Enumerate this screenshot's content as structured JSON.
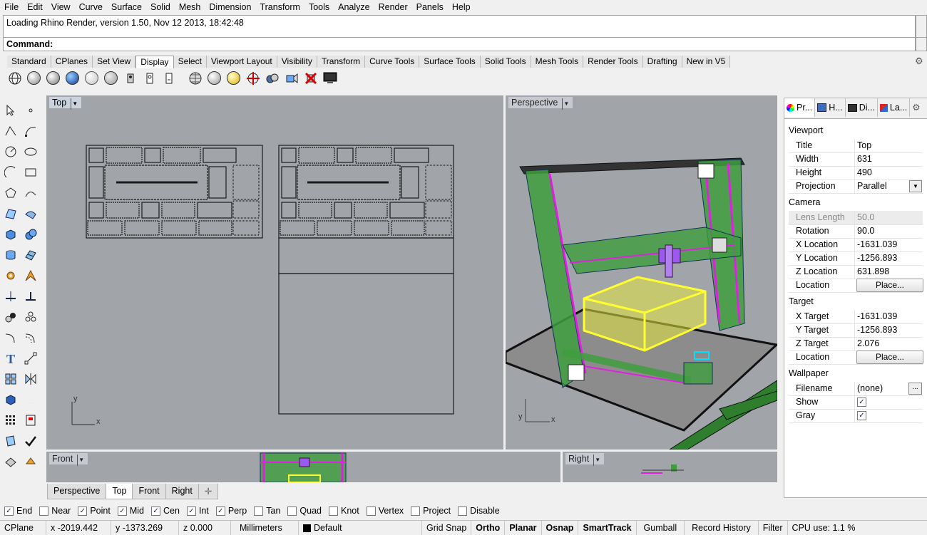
{
  "menu": [
    "File",
    "Edit",
    "View",
    "Curve",
    "Surface",
    "Solid",
    "Mesh",
    "Dimension",
    "Transform",
    "Tools",
    "Analyze",
    "Render",
    "Panels",
    "Help"
  ],
  "command": {
    "history": "Loading Rhino Render, version 1.50, Nov 12 2013, 18:42:48",
    "prompt": "Command:"
  },
  "toolbar_tabs": [
    "Standard",
    "CPlanes",
    "Set View",
    "Display",
    "Select",
    "Viewport Layout",
    "Visibility",
    "Transform",
    "Curve Tools",
    "Surface Tools",
    "Solid Tools",
    "Mesh Tools",
    "Render Tools",
    "Drafting",
    "New in V5"
  ],
  "active_toolbar_tab": "Display",
  "viewports": {
    "top": {
      "title": "Top"
    },
    "perspective": {
      "title": "Perspective"
    },
    "front": {
      "title": "Front"
    },
    "right": {
      "title": "Right"
    },
    "axis_x": "x",
    "axis_y": "y"
  },
  "viewport_tabs": [
    "Perspective",
    "Top",
    "Front",
    "Right"
  ],
  "active_viewport_tab": "Top",
  "panel": {
    "tabs": [
      "Pr...",
      "H...",
      "Di...",
      "La..."
    ],
    "viewport_section": "Viewport",
    "camera_section": "Camera",
    "target_section": "Target",
    "wallpaper_section": "Wallpaper",
    "title_label": "Title",
    "title_value": "Top",
    "width_label": "Width",
    "width_value": "631",
    "height_label": "Height",
    "height_value": "490",
    "projection_label": "Projection",
    "projection_value": "Parallel",
    "lens_label": "Lens Length",
    "lens_value": "50.0",
    "rotation_label": "Rotation",
    "rotation_value": "90.0",
    "cam_x_label": "X Location",
    "cam_x_value": "-1631.039",
    "cam_y_label": "Y Location",
    "cam_y_value": "-1256.893",
    "cam_z_label": "Z Location",
    "cam_z_value": "631.898",
    "cam_loc_label": "Location",
    "place_button": "Place...",
    "tgt_x_label": "X Target",
    "tgt_x_value": "-1631.039",
    "tgt_y_label": "Y Target",
    "tgt_y_value": "-1256.893",
    "tgt_z_label": "Z Target",
    "tgt_z_value": "2.076",
    "tgt_loc_label": "Location",
    "filename_label": "Filename",
    "filename_value": "(none)",
    "browse": "...",
    "show_label": "Show",
    "show_checked": true,
    "gray_label": "Gray",
    "gray_checked": true
  },
  "osnaps": [
    {
      "label": "End",
      "checked": true
    },
    {
      "label": "Near",
      "checked": false
    },
    {
      "label": "Point",
      "checked": true
    },
    {
      "label": "Mid",
      "checked": true
    },
    {
      "label": "Cen",
      "checked": true
    },
    {
      "label": "Int",
      "checked": true
    },
    {
      "label": "Perp",
      "checked": true
    },
    {
      "label": "Tan",
      "checked": false
    },
    {
      "label": "Quad",
      "checked": false
    },
    {
      "label": "Knot",
      "checked": false
    },
    {
      "label": "Vertex",
      "checked": false
    },
    {
      "label": "Project",
      "checked": false
    },
    {
      "label": "Disable",
      "checked": false
    }
  ],
  "status": {
    "cplane": "CPlane",
    "x": "x -2019.442",
    "y": "y -1373.269",
    "z": "z 0.000",
    "units": "Millimeters",
    "layer": "Default",
    "grid_snap": "Grid Snap",
    "ortho": "Ortho",
    "planar": "Planar",
    "osnap": "Osnap",
    "smarttrack": "SmartTrack",
    "gumball": "Gumball",
    "record_history": "Record History",
    "filter": "Filter",
    "cpu": "CPU use: 1.1 %"
  },
  "colors": {
    "viewport_bg": "#a1a5aa",
    "frame_green": "#2e9e2e",
    "magenta": "#e020e0",
    "yellow": "#ffff40"
  }
}
